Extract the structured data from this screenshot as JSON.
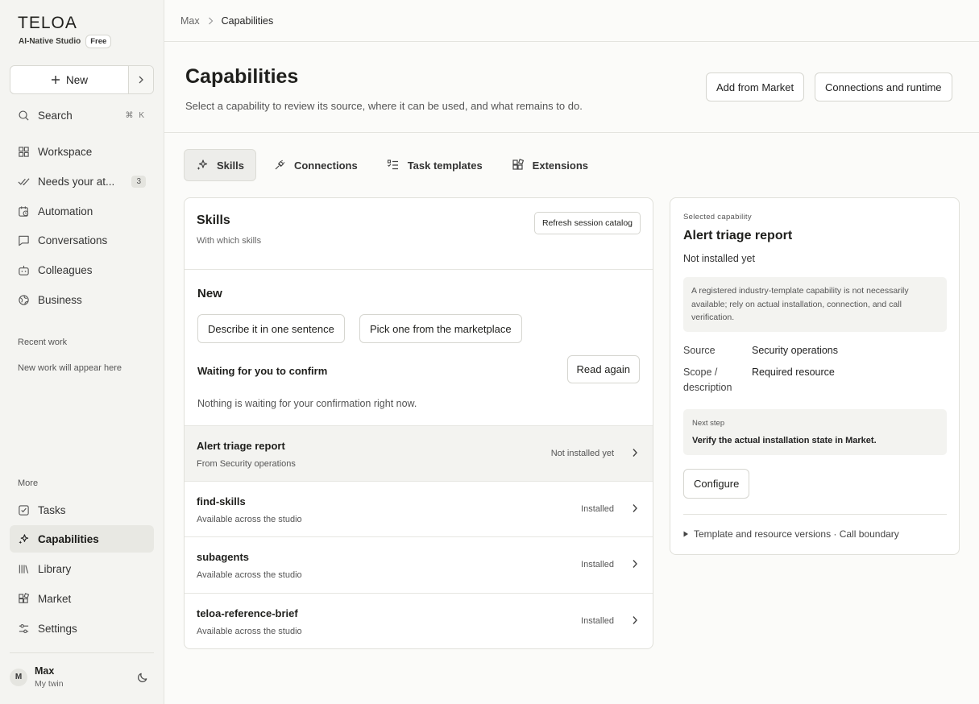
{
  "app": {
    "logo": "TELOA",
    "studio": "AI-Native Studio",
    "plan": "Free"
  },
  "sidebar": {
    "new_label": "New",
    "search_label": "Search",
    "search_shortcut": "⌘ K",
    "nav": [
      {
        "label": "Workspace",
        "icon": "grid-icon"
      },
      {
        "label": "Needs your at...",
        "icon": "double-check-icon",
        "count": "3"
      },
      {
        "label": "Automation",
        "icon": "calendar-clock-icon"
      },
      {
        "label": "Conversations",
        "icon": "chat-icon"
      },
      {
        "label": "Colleagues",
        "icon": "bot-icon"
      },
      {
        "label": "Business",
        "icon": "globe-icon"
      }
    ],
    "recent_label": "Recent work",
    "recent_empty": "New work will appear here",
    "more_label": "More",
    "more_nav": [
      {
        "label": "Tasks",
        "icon": "checkbox-icon"
      },
      {
        "label": "Capabilities",
        "icon": "sparkles-icon",
        "active": true
      },
      {
        "label": "Library",
        "icon": "books-icon"
      },
      {
        "label": "Market",
        "icon": "blocks-icon"
      },
      {
        "label": "Settings",
        "icon": "sliders-icon"
      }
    ],
    "user": {
      "initial": "M",
      "name": "Max",
      "subtitle": "My twin"
    }
  },
  "breadcrumb": {
    "root": "Max",
    "current": "Capabilities"
  },
  "header": {
    "title": "Capabilities",
    "subtitle": "Select a capability to review its source, where it can be used, and what remains to do.",
    "add_market": "Add from Market",
    "connections_runtime": "Connections and runtime"
  },
  "tabs": [
    {
      "label": "Skills",
      "active": true
    },
    {
      "label": "Connections"
    },
    {
      "label": "Task templates"
    },
    {
      "label": "Extensions"
    }
  ],
  "skills_panel": {
    "title": "Skills",
    "subtitle": "With which skills",
    "refresh": "Refresh session catalog",
    "new_title": "New",
    "describe_btn": "Describe it in one sentence",
    "pick_btn": "Pick one from the marketplace",
    "waiting_title": "Waiting for you to confirm",
    "read_again": "Read again",
    "waiting_empty": "Nothing is waiting for your confirmation right now.",
    "rows": [
      {
        "name": "Alert triage report",
        "sub": "From Security operations",
        "status": "Not installed yet",
        "selected": true
      },
      {
        "name": "find-skills",
        "sub": "Available across the studio",
        "status": "Installed"
      },
      {
        "name": "subagents",
        "sub": "Available across the studio",
        "status": "Installed"
      },
      {
        "name": "teloa-reference-brief",
        "sub": "Available across the studio",
        "status": "Installed"
      }
    ]
  },
  "detail": {
    "eyebrow": "Selected capability",
    "title": "Alert triage report",
    "state": "Not installed yet",
    "note": "A registered industry-template capability is not necessarily available; rely on actual installation, connection, and call verification.",
    "source_label": "Source",
    "source_value": "Security operations",
    "scope_label": "Scope / description",
    "scope_value": "Required resource",
    "next_label": "Next step",
    "next_text": "Verify the actual installation state in Market.",
    "configure": "Configure",
    "details_summary": "Template and resource versions · Call boundary"
  }
}
